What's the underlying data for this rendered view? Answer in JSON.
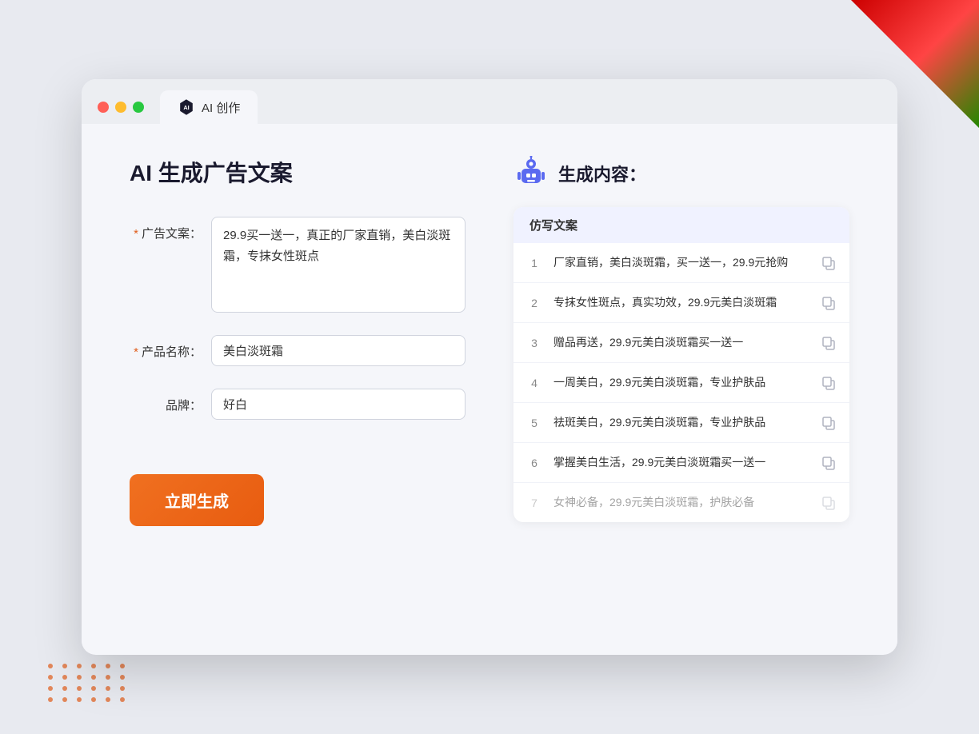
{
  "browser": {
    "tab_label": "AI 创作",
    "window_controls": {
      "close": "close",
      "minimize": "minimize",
      "maximize": "maximize"
    }
  },
  "page": {
    "title": "AI 生成广告文案",
    "result_title": "生成内容："
  },
  "form": {
    "ad_copy_label": "广告文案：",
    "ad_copy_required": "*",
    "ad_copy_value": "29.9买一送一，真正的厂家直销，美白淡斑霜，专抹女性斑点",
    "product_name_label": "产品名称：",
    "product_name_required": "*",
    "product_name_value": "美白淡斑霜",
    "brand_label": "品牌：",
    "brand_value": "好白",
    "generate_button": "立即生成"
  },
  "results": {
    "table_header": "仿写文案",
    "rows": [
      {
        "num": "1",
        "text": "厂家直销，美白淡斑霜，买一送一，29.9元抢购",
        "faded": false
      },
      {
        "num": "2",
        "text": "专抹女性斑点，真实功效，29.9元美白淡斑霜",
        "faded": false
      },
      {
        "num": "3",
        "text": "赠品再送，29.9元美白淡斑霜买一送一",
        "faded": false
      },
      {
        "num": "4",
        "text": "一周美白，29.9元美白淡斑霜，专业护肤品",
        "faded": false
      },
      {
        "num": "5",
        "text": "祛斑美白，29.9元美白淡斑霜，专业护肤品",
        "faded": false
      },
      {
        "num": "6",
        "text": "掌握美白生活，29.9元美白淡斑霜买一送一",
        "faded": false
      },
      {
        "num": "7",
        "text": "女神必备，29.9元美白淡斑霜，护肤必备",
        "faded": true
      }
    ]
  }
}
